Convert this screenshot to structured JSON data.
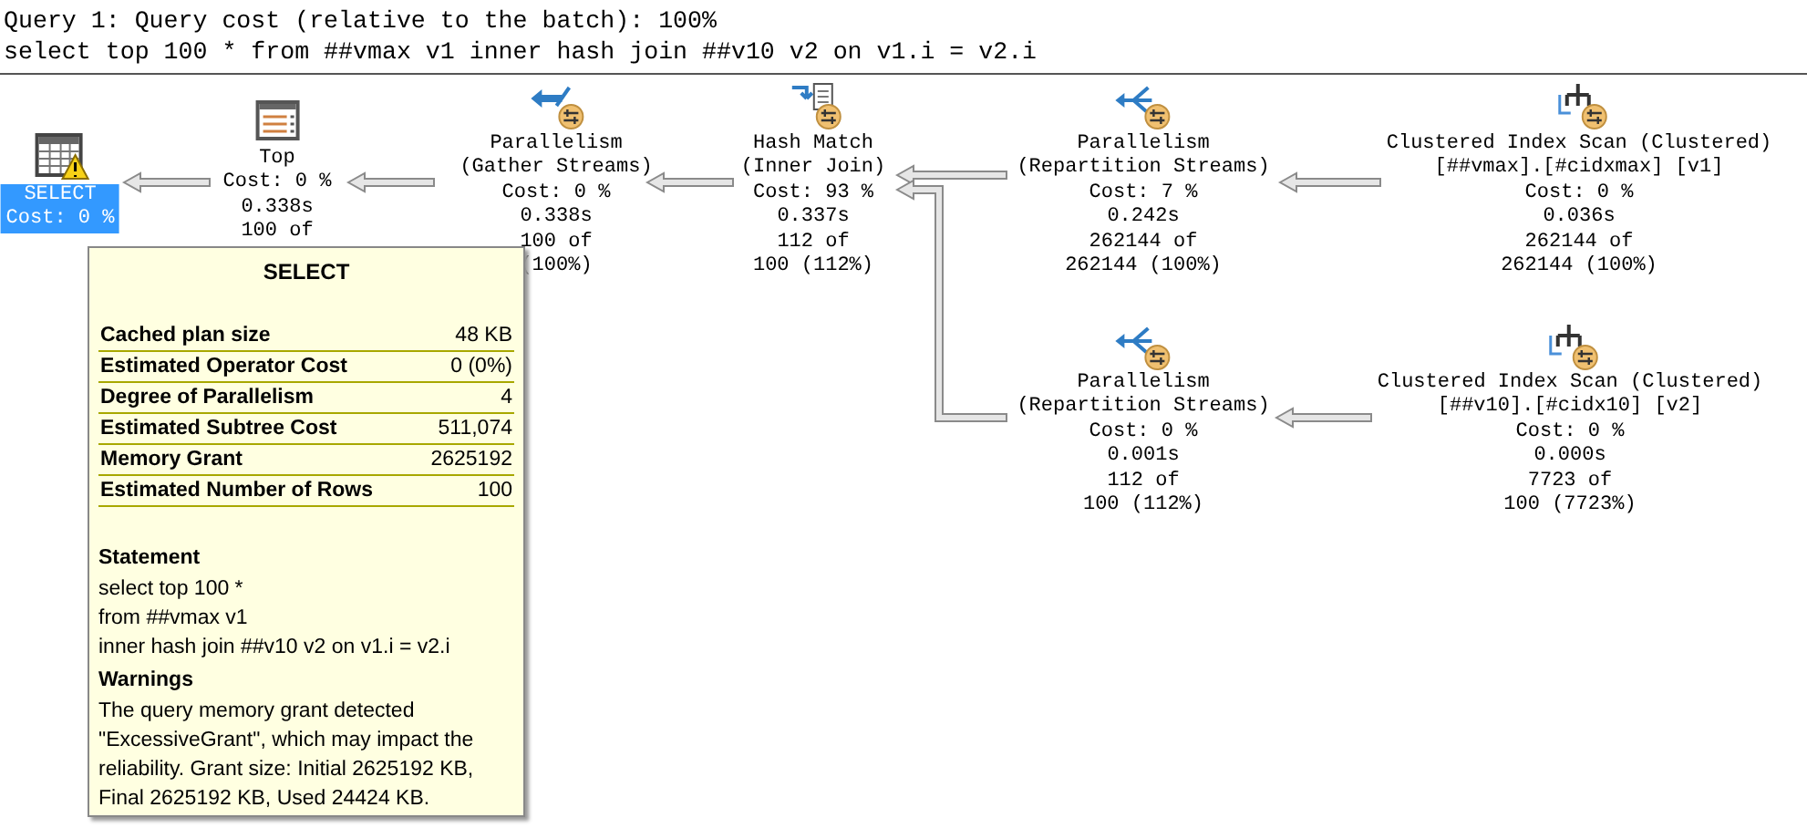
{
  "header": {
    "title": "Query 1: Query cost (relative to the batch): 100%",
    "sql": "select top 100 * from ##vmax v1 inner hash join ##v10 v2 on v1.i = v2.i"
  },
  "nodes": [
    {
      "kind": "select",
      "selected": true,
      "warning": true,
      "parallel": false,
      "lines": [
        "SELECT",
        "Cost: 0 %"
      ]
    },
    {
      "kind": "top",
      "selected": false,
      "warning": false,
      "parallel": false,
      "lines": [
        "Top",
        "Cost: 0 %",
        "0.338s",
        "100 of"
      ]
    },
    {
      "kind": "gather",
      "selected": false,
      "warning": false,
      "parallel": true,
      "lines": [
        "Parallelism",
        "(Gather Streams)",
        "Cost: 0 %",
        "0.338s",
        "100 of",
        "(100%)"
      ]
    },
    {
      "kind": "hash",
      "selected": false,
      "warning": false,
      "parallel": true,
      "lines": [
        "Hash Match",
        "(Inner Join)",
        "Cost: 93 %",
        "0.337s",
        "112 of",
        "100 (112%)"
      ]
    },
    {
      "kind": "repartition",
      "selected": false,
      "warning": false,
      "parallel": true,
      "lines": [
        "Parallelism",
        "(Repartition Streams)",
        "Cost: 7 %",
        "0.242s",
        "262144 of",
        "262144 (100%)"
      ]
    },
    {
      "kind": "scan",
      "selected": false,
      "warning": false,
      "parallel": true,
      "lines": [
        "Clustered Index Scan (Clustered)",
        "[##vmax].[#cidxmax] [v1]",
        "Cost: 0 %",
        "0.036s",
        "262144 of",
        "262144 (100%)"
      ]
    },
    {
      "kind": "repartition",
      "selected": false,
      "warning": false,
      "parallel": true,
      "lines": [
        "Parallelism",
        "(Repartition Streams)",
        "Cost: 0 %",
        "0.001s",
        "112 of",
        "100 (112%)"
      ]
    },
    {
      "kind": "scan",
      "selected": false,
      "warning": false,
      "parallel": true,
      "lines": [
        "Clustered Index Scan (Clustered)",
        "[##v10].[#cidx10] [v2]",
        "Cost: 0 %",
        "0.000s",
        "7723 of",
        "100 (7723%)"
      ]
    }
  ],
  "tooltip": {
    "title": "SELECT",
    "properties": [
      {
        "name": "Cached plan size",
        "value": "48 KB"
      },
      {
        "name": "Estimated Operator Cost",
        "value": "0 (0%)"
      },
      {
        "name": "Degree of Parallelism",
        "value": "4"
      },
      {
        "name": "Estimated Subtree Cost",
        "value": "511,074"
      },
      {
        "name": "Memory Grant",
        "value": "2625192"
      },
      {
        "name": "Estimated Number of Rows",
        "value": "100"
      }
    ],
    "statement_heading": "Statement",
    "statement_lines": [
      "select top 100 *",
      "from ##vmax v1",
      "inner hash join ##v10 v2 on v1.i = v2.i"
    ],
    "warnings_heading": "Warnings",
    "warnings_text": "The query memory grant detected \"ExcessiveGrant\", which may impact the reliability. Grant size: Initial 2625192 KB, Final 2625192 KB, Used 24424 KB."
  }
}
